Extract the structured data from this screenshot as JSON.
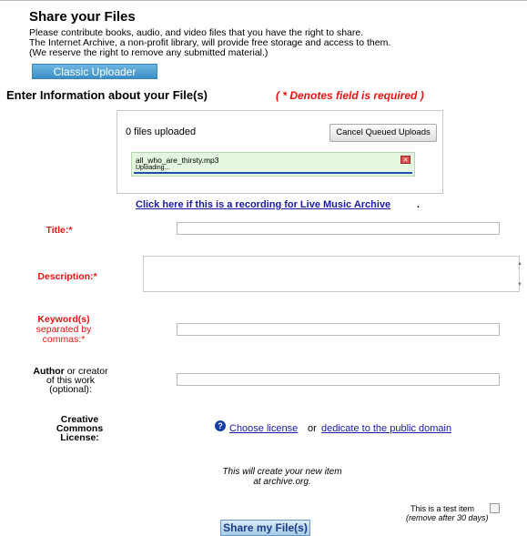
{
  "header": {
    "title": "Share your Files",
    "intro_line1": "Please contribute books, audio, and video files that you have the right to share.",
    "intro_line2": "The Internet Archive, a non-profit library, will provide free storage and access to them.",
    "intro_line3": "(We reserve the right to remove any submitted material.)"
  },
  "uploader": {
    "classic_label": "Classic Uploader"
  },
  "section": {
    "title": "Enter Information about your File(s)",
    "required_note": "( * Denotes field is required )"
  },
  "upload_box": {
    "files_uploaded": "0 files uploaded",
    "cancel_label": "Cancel Queued Uploads",
    "queue": {
      "filename": "all_who_are_thirsty.mp3",
      "status": "Uploading...",
      "progress": 1.0
    }
  },
  "lma_link": "Click here if this is a recording for Live Music Archive",
  "lma_period": ".",
  "fields": {
    "title_label": "Title:*",
    "description_label": "Description:*",
    "keywords_label": "Keyword(s)",
    "keywords_sub1": "separated by",
    "keywords_sub2": "commas:*",
    "author_label_bold": "Author",
    "author_label_rest": " or creator",
    "author_sub1": "of this work",
    "author_sub2": "(optional):",
    "title_value": "",
    "description_value": "",
    "keywords_value": "",
    "author_value": ""
  },
  "license": {
    "label1": "Creative",
    "label2": "Commons",
    "label3": "License:",
    "icon": "question-icon",
    "choose_link": "Choose license",
    "or_text": "or",
    "domain_link": "dedicate to the public domain"
  },
  "footer": {
    "create_note1": "This will create your new item",
    "create_note2": "at archive.org.",
    "test_label": "This is a test item",
    "test_note": "(remove after 30 days)",
    "share_label": "Share my File(s)"
  },
  "colors": {
    "required_red": "#e11111",
    "link_blue": "#1a1aa6",
    "classic_button": "#3b8fc6",
    "queue_bg": "#e4f6df",
    "progress_bar": "#1e4fb0"
  }
}
